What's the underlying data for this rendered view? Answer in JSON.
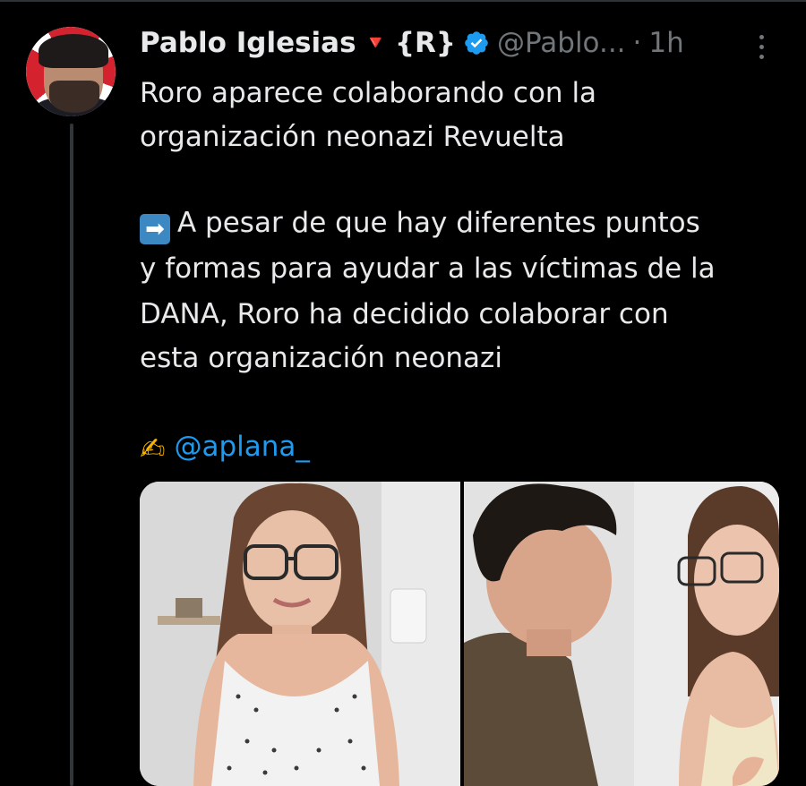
{
  "author": {
    "name": "Pablo Iglesias",
    "flag_glyph": "🔻",
    "tag": "{R}",
    "handle": "@Pablo...",
    "separator": "·",
    "time": "1h"
  },
  "tweet": {
    "line1": "Roro aparece colaborando con la",
    "line2": "organización neonazi Revuelta",
    "arrow_emoji": "➡",
    "para2_line1": "A pesar de que hay diferentes puntos",
    "para2_line2": "y formas para ayudar a las víctimas de la",
    "para2_line3": "DANA, Roro ha decidido colaborar con",
    "para2_line4": "esta organización neonazi",
    "writing_emoji": "✍",
    "mention": "@aplana_"
  },
  "colors": {
    "background": "#000000",
    "text": "#e7e9ea",
    "secondary": "#71767b",
    "link": "#1d9bf0",
    "verified": "#1d9bf0"
  },
  "icons": [
    "verified-badge-icon",
    "more-options-icon",
    "red-triangle-icon",
    "arrow-right-emoji-icon",
    "writing-hand-emoji-icon"
  ]
}
